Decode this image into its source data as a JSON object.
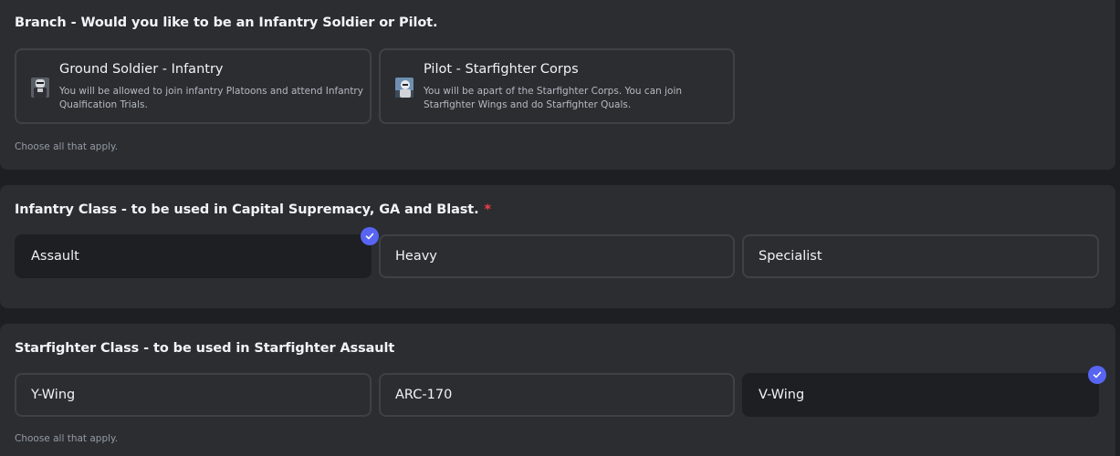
{
  "branch": {
    "title": "Branch - Would you like to be an Infantry Soldier or Pilot.",
    "options": [
      {
        "title": "Ground Soldier - Infantry",
        "description": "You will be allowed to join infantry Platoons and attend Infantry Qualfication Trials.",
        "icon": "infantry-soldier-icon"
      },
      {
        "title": "Pilot - Starfighter Corps",
        "description": "You will be apart of the Starfighter Corps. You can join Starfighter Wings and do Starfighter Quals.",
        "icon": "pilot-icon"
      }
    ],
    "hint": "Choose all that apply."
  },
  "infantry_class": {
    "title": "Infantry Class - to be used in Capital Supremacy, GA and Blast.",
    "required_mark": "*",
    "options": [
      {
        "label": "Assault",
        "selected": true
      },
      {
        "label": "Heavy",
        "selected": false
      },
      {
        "label": "Specialist",
        "selected": false
      }
    ]
  },
  "starfighter_class": {
    "title": "Starfighter Class - to be used in Starfighter Assault",
    "options": [
      {
        "label": "Y-Wing",
        "selected": false
      },
      {
        "label": "ARC-170",
        "selected": false
      },
      {
        "label": "V-Wing",
        "selected": true
      }
    ],
    "hint": "Choose all that apply."
  },
  "colors": {
    "background": "#1e1f22",
    "card": "#2b2d31",
    "border": "#3f4147",
    "accent": "#5865f2",
    "required": "#f23f43"
  }
}
